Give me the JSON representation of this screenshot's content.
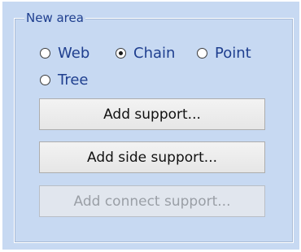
{
  "group": {
    "title": "New area"
  },
  "area_type": {
    "options": [
      {
        "label": "Web",
        "selected": false
      },
      {
        "label": "Chain",
        "selected": true
      },
      {
        "label": "Point",
        "selected": false
      },
      {
        "label": "Tree",
        "selected": false
      }
    ]
  },
  "buttons": {
    "add_support": {
      "label": "Add support...",
      "enabled": true
    },
    "add_side_support": {
      "label": "Add side support...",
      "enabled": true
    },
    "add_connect_support": {
      "label": "Add connect support...",
      "enabled": false
    }
  },
  "colors": {
    "panel_background": "#c7d9f2",
    "label_text": "#1f3f8f",
    "button_text": "#111111",
    "disabled_text": "#9a9fa6"
  }
}
